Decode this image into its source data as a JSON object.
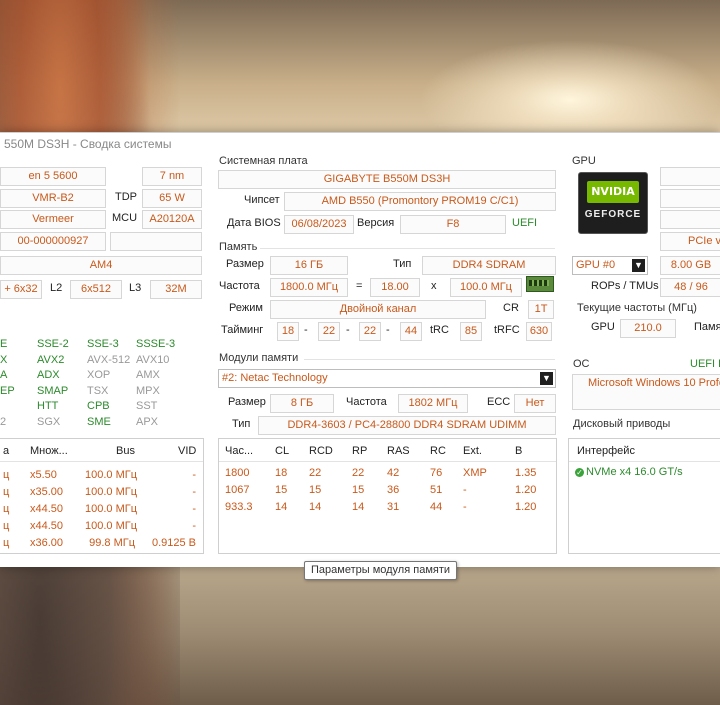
{
  "window": {
    "title": "550M DS3H - Сводка системы"
  },
  "cpu": {
    "name": "en 5 5600",
    "process": "7 nm",
    "stepping": "VMR-B2",
    "tdp_label": "TDP",
    "tdp": "65 W",
    "codename": "Vermeer",
    "mcu_label": "MCU",
    "mcu": "A20120A",
    "sspec": "00-000000927",
    "socket": "AM4",
    "l1": "+ 6x32",
    "l2_label": "L2",
    "l2": "6x512",
    "l3_label": "L3",
    "l3": "32M",
    "features": [
      {
        "name": "E",
        "state": "on"
      },
      {
        "name": "SSE-2",
        "state": "on"
      },
      {
        "name": "SSE-3",
        "state": "on"
      },
      {
        "name": "SSSE-3",
        "state": "on"
      },
      {
        "name": "X",
        "state": "on"
      },
      {
        "name": "AVX2",
        "state": "on"
      },
      {
        "name": "AVX-512",
        "state": "off"
      },
      {
        "name": "AVX10",
        "state": "off"
      },
      {
        "name": "A",
        "state": "on"
      },
      {
        "name": "ADX",
        "state": "on"
      },
      {
        "name": "XOP",
        "state": "off"
      },
      {
        "name": "AMX",
        "state": "off"
      },
      {
        "name": "EP",
        "state": "on"
      },
      {
        "name": "SMAP",
        "state": "on"
      },
      {
        "name": "TSX",
        "state": "off"
      },
      {
        "name": "MPX",
        "state": "off"
      },
      {
        "name": "",
        "state": "on"
      },
      {
        "name": "HTT",
        "state": "on"
      },
      {
        "name": "CPB",
        "state": "on"
      },
      {
        "name": "SST",
        "state": "off"
      },
      {
        "name": "2",
        "state": "off"
      },
      {
        "name": "SGX",
        "state": "off"
      },
      {
        "name": "SME",
        "state": "on"
      },
      {
        "name": "APX",
        "state": "off"
      }
    ],
    "clocks_headers": [
      "a",
      "Множ...",
      "Bus",
      "VID"
    ],
    "clocks_rows": [
      [
        "ц",
        "x5.50",
        "100.0 МГц",
        "-"
      ],
      [
        "ц",
        "x35.00",
        "100.0 МГц",
        "-"
      ],
      [
        "ц",
        "x44.50",
        "100.0 МГц",
        "-"
      ],
      [
        "ц",
        "x44.50",
        "100.0 МГц",
        "-"
      ],
      [
        "ц",
        "x36.00",
        "99.8 МГц",
        "0.9125 В"
      ]
    ]
  },
  "motherboard": {
    "group": "Системная плата",
    "name": "GIGABYTE B550M DS3H",
    "chipset_label": "Чипсет",
    "chipset": "AMD B550 (Promontory PROM19 C/C1)",
    "bios_date_label": "Дата BIOS",
    "bios_date": "06/08/2023",
    "version_label": "Версия",
    "version": "F8",
    "uefi": "UEFI"
  },
  "memory": {
    "group": "Память",
    "size_label": "Размер",
    "size": "16 ГБ",
    "type_label": "Тип",
    "type": "DDR4 SDRAM",
    "freq_label": "Частота",
    "freq": "1800.0 МГц",
    "eq": "=",
    "mult": "18.00",
    "x": "x",
    "bus": "100.0 МГц",
    "mode_label": "Режим",
    "mode": "Двойной канал",
    "cr_label": "CR",
    "cr": "1T",
    "timing_label": "Тайминг",
    "timings": [
      "18",
      "22",
      "22",
      "44"
    ],
    "dash": "-",
    "trc_label": "tRC",
    "trc": "85",
    "trfc_label": "tRFC",
    "trfc": "630"
  },
  "modules": {
    "group": "Модули памяти",
    "selected": "#2: Netac Technology",
    "size_label": "Размер",
    "size": "8 ГБ",
    "freq_label": "Частота",
    "freq": "1802 МГц",
    "ecc_label": "ECC",
    "ecc": "Нет",
    "type_label": "Тип",
    "type": "DDR4-3603 / PC4-28800 DDR4 SDRAM UDIMM",
    "headers": [
      "Час...",
      "CL",
      "RCD",
      "RP",
      "RAS",
      "RC",
      "Ext.",
      "В"
    ],
    "rows": [
      [
        "1800",
        "18",
        "22",
        "22",
        "42",
        "76",
        "XMP",
        "1.35"
      ],
      [
        "1067",
        "15",
        "15",
        "15",
        "36",
        "51",
        "-",
        "1.20"
      ],
      [
        "933.3",
        "14",
        "14",
        "14",
        "31",
        "44",
        "-",
        "1.20"
      ]
    ],
    "tooltip": "Параметры модуля памяти"
  },
  "gpu": {
    "group": "GPU",
    "logo_brand": "NVIDIA",
    "logo_sub": "GEFORCE",
    "pcie": "PCIe v",
    "selected": "GPU #0",
    "vram": "8.00 GB",
    "rops_label": "ROPs / TMUs",
    "rops": "48 / 96",
    "clocks_group": "Текущие частоты (МГц)",
    "gpu_clock_label": "GPU",
    "gpu_clock": "210.0",
    "mem_label": "Памя"
  },
  "os": {
    "group": "ОС",
    "uefi": "UEFI B",
    "name": "Microsoft Windows 10 Profe"
  },
  "drives": {
    "group": "Дисковый приводы",
    "header": "Интерфейс",
    "items": [
      "NVMe x4 16.0 GT/s"
    ]
  }
}
